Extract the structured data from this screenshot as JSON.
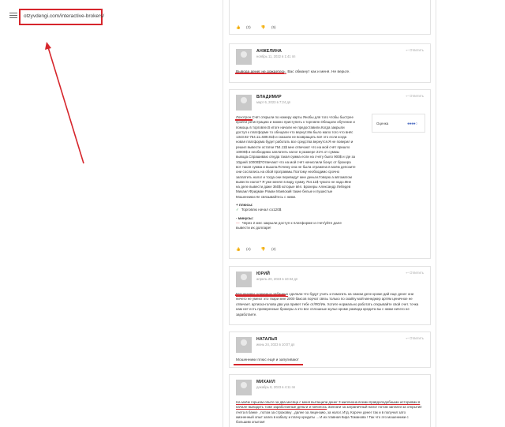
{
  "address_bar": {
    "url": "otzyvdengi.com/interactive-brokers/"
  },
  "comments": [
    {
      "id": "top",
      "votes_up": "(3)",
      "votes_down": "(5)"
    },
    {
      "id": "angelina",
      "name": "АНЖЕЛИНА",
      "date": "ноябрь 11, 2022 в 1:41 пп",
      "reply": "Ответить",
      "highlight": "Вывода денег не дождетесь.",
      "text": "Вас обманут как и меня. Не верьте."
    },
    {
      "id": "vladimir",
      "name": "ВЛАДИМИР",
      "date": "март 6, 2023 в 7:24 дп",
      "reply": "Ответить",
      "highlight": "Лохотрон",
      "text": "Счёт открыли по номеру карты Янобы для того чтобы быстрее пройти регистрацию и можно приступить к торговле.Обещали обучение и помощь в торговле.В итоге начали не предоставили.Когда закрыли доступ к платформе то обещали что вернут.Им было мало того что внёс 1343.92-754.11=589.81$ и сказали не возвращать всё это если когда новая платформа будет работать все средства вернутся.Я не поверил и решил вывести остатки 754.11$ мне отвечают что на мой счёт пришло 10000$ и необходимо заплатить налог в размере 21% от суммы вывода.Спрашиваю откуда такая сумма если на счету было 900$ и где за 10дней 10000$?Отвечают что на мой счёт начислили бонус от брокера вот такая сумма и вышла.Почему она не была отражена в моём депозите они сослались на обой программы.Поэтому необходимо срочно заплатить налог и тогда они переведут мне деньги.Говорю а автоматом вывести налог? Я уже менял в виду сумму 754.11$ чужого не надо.Мне на деле вывести даже 360$ которые вёл. Брокеры Александр Лебедев Михаил Фридман Роман Мзевский такие белые и пушистые Мошенники.Не связывайтесь с ними.",
      "rating_label": "Оценка",
      "rating_value": 4,
      "rating_max": 5,
      "pros_header": "+ плюсы:",
      "pro_item": "Торговлю начал со120$",
      "cons_header": "- минусы:",
      "con_item": "Через 2 мес закрыли доступ к платформе и счет/уйте дале вывести их долларе!",
      "votes_up": "(4)",
      "votes_down": "(2)"
    },
    {
      "id": "yuri",
      "name": "ЮРИЙ",
      "date": "апрель 20, 2023 в 10:34 дп",
      "reply": "Ответить",
      "highlight": "Мошенники, конченые забанено",
      "text": "сделали что будут учить и помогать на самом деле кроме дай еще денег они ничего не умеют это твари мне 2000 баксов порчат связь только по скайпу мой менеджер артём ценичное не отвечает. артиска-голова два уха привет тебе от/ЯО/Ин. Хотите нормально работать открывайте свой счет. точка нам нет есть проверенные брокеры а это все сплошные жулье кроме развода кредита вы с ними ничего не заработаете."
    },
    {
      "id": "natalia",
      "name": "НАТАЛЬЯ",
      "date": "июнь 24, 2023 в 10:07 дп",
      "reply": "Ответить",
      "highlight": "Мошенники плюс ещё и запугивают"
    },
    {
      "id": "mikhail",
      "name": "МИХАИЛ",
      "date": "декабрь 8, 2023 в 4:11 пп",
      "reply": "Ответить",
      "highlight": "На моём горьком опыте за два месяца с меня вытащили денег 3 миллиона всеми правдоподобными историями в начале выводить тоже заработанные деньги и начилось",
      "text": "Заплати за заграничный налог потом заплати за открытие счета в банке , потом за страховку , далее за лицензию, за налог. Итд. Короче денег так и в получил зато жизненный опыт залез в кабалу и плачу кредиты ... И их главная Кира Томанова ! Так что это мошенники с большим опытом!"
    }
  ],
  "colors": {
    "annotation_red": "#d6262c",
    "rating_blue": "#5271c4"
  }
}
